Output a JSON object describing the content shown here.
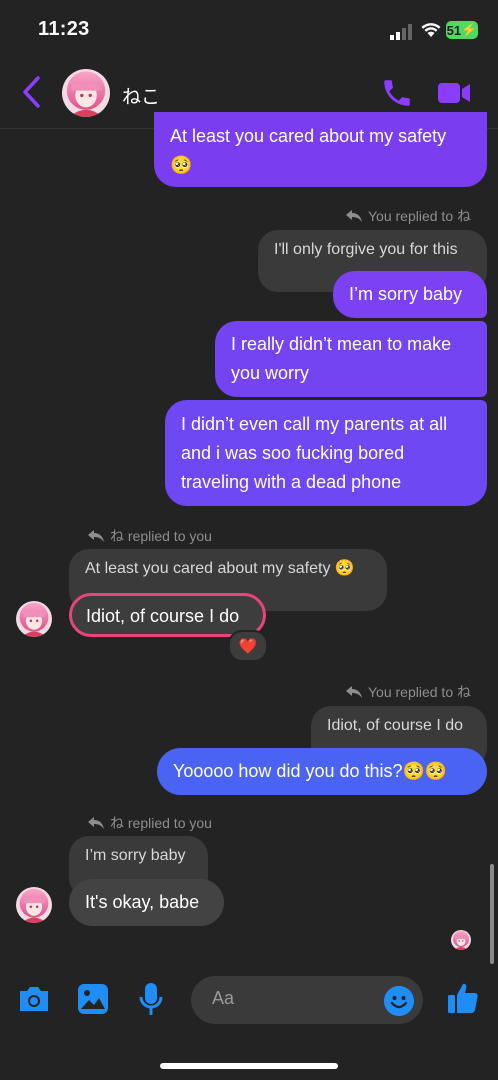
{
  "status_bar": {
    "time": "11:23",
    "battery": "51"
  },
  "header": {
    "contact_name": "ねこ"
  },
  "messages": {
    "m1": "At least you cared about my safety",
    "m1_emoji": "🥺",
    "reply1": "You replied to ね",
    "q1": "I'll only forgive you for this",
    "m2": "I’m sorry baby",
    "m3": "I really didn’t mean to make you worry",
    "m4": "I didn’t even call my parents at all and i was soo fucking bored traveling with a dead phone",
    "reply2": "ね replied to you",
    "q2": "At least you cared about my safety 🥺",
    "m5": "Idiot, of course I do",
    "reaction": "❤️",
    "reply3": "You replied to ね",
    "q3": "Idiot, of course I do",
    "m6": "Yooooo how did you do this?🥺🥺",
    "reply4": "ね replied to you",
    "q4": "I’m sorry baby",
    "m7": "It's okay, babe"
  },
  "composer": {
    "placeholder": "Aa"
  },
  "colors": {
    "accent": "#8b3dff",
    "outgoing": "#7a3ef0",
    "outgoing_blue": "#4b63f3",
    "incoming": "#3d3d3d",
    "highlight": "#e8457a"
  },
  "icons": [
    "back-chevron-icon",
    "phone-icon",
    "video-icon",
    "camera-icon",
    "gallery-icon",
    "microphone-icon",
    "emoji-icon",
    "thumbs-up-icon",
    "reply-icon"
  ]
}
